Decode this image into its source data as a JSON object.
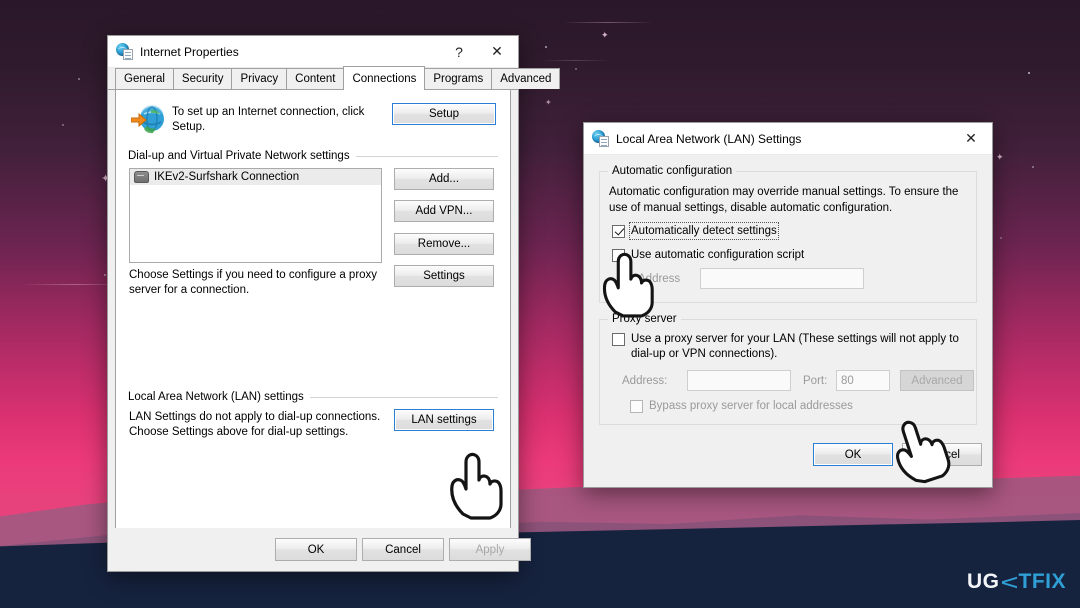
{
  "desktop": {
    "watermark": {
      "part1": "UG",
      "logo": "ugetfix-logo-icon",
      "part2": "TFIX"
    }
  },
  "internet_properties": {
    "title": "Internet Properties",
    "icon": "internet-properties-icon",
    "help_label": "?",
    "close_label": "✕",
    "tabs": [
      {
        "label": "General",
        "active": false
      },
      {
        "label": "Security",
        "active": false
      },
      {
        "label": "Privacy",
        "active": false
      },
      {
        "label": "Content",
        "active": false
      },
      {
        "label": "Connections",
        "active": true
      },
      {
        "label": "Programs",
        "active": false
      },
      {
        "label": "Advanced",
        "active": false
      }
    ],
    "setup": {
      "icon": "globe-with-arrow-icon",
      "text_line1": "To set up an Internet connection, click",
      "text_line2": "Setup.",
      "button_label": "Setup"
    },
    "dialup_group": {
      "label": "Dial-up and Virtual Private Network settings",
      "list_items": [
        {
          "icon": "modem-icon",
          "label": "IKEv2-Surfshark Connection",
          "selected": true
        }
      ],
      "buttons": [
        {
          "label": "Add...",
          "disabled": false
        },
        {
          "label": "Add VPN...",
          "disabled": false
        },
        {
          "label": "Remove...",
          "disabled": false
        },
        {
          "label": "Settings",
          "disabled": false
        }
      ],
      "hint_line1": "Choose Settings if you need to configure a proxy",
      "hint_line2": "server for a connection."
    },
    "lan_group": {
      "label": "Local Area Network (LAN) settings",
      "hint_line1": "LAN Settings do not apply to dial-up connections.",
      "hint_line2": "Choose Settings above for dial-up settings.",
      "button_label": "LAN settings"
    },
    "footer_buttons": [
      {
        "label": "OK",
        "disabled": false
      },
      {
        "label": "Cancel",
        "disabled": false
      },
      {
        "label": "Apply",
        "disabled": true
      }
    ]
  },
  "lan_settings": {
    "title": "Local Area Network (LAN) Settings",
    "icon": "lan-settings-icon",
    "close_label": "✕",
    "automatic_configuration": {
      "group_label": "Automatic configuration",
      "description_line1": "Automatic configuration may override manual settings.  To ensure the",
      "description_line2": "use of manual settings, disable automatic configuration.",
      "auto_detect": {
        "label": "Automatically detect settings",
        "checked": true,
        "focused": true
      },
      "use_script": {
        "label": "Use automatic configuration script",
        "checked": false
      },
      "address_label": "Address",
      "address_value": "",
      "address_disabled": true
    },
    "proxy_server": {
      "group_label": "Proxy server",
      "use_proxy": {
        "label_line1": "Use a proxy server for your LAN (These settings will not apply to",
        "label_line2": "dial-up or VPN connections).",
        "checked": false
      },
      "address_label": "Address:",
      "address_value": "",
      "port_label": "Port:",
      "port_value": "80",
      "advanced_label": "Advanced",
      "advanced_disabled": true,
      "bypass": {
        "label": "Bypass proxy server for local addresses",
        "checked": false,
        "disabled": true
      }
    },
    "footer_buttons": [
      {
        "label": "OK",
        "default": true
      },
      {
        "label": "Cancel",
        "default": false
      }
    ]
  },
  "cursors": [
    {
      "name": "hand-cursor-lan-settings"
    },
    {
      "name": "hand-cursor-auto-config-script"
    },
    {
      "name": "hand-cursor-cancel"
    }
  ]
}
